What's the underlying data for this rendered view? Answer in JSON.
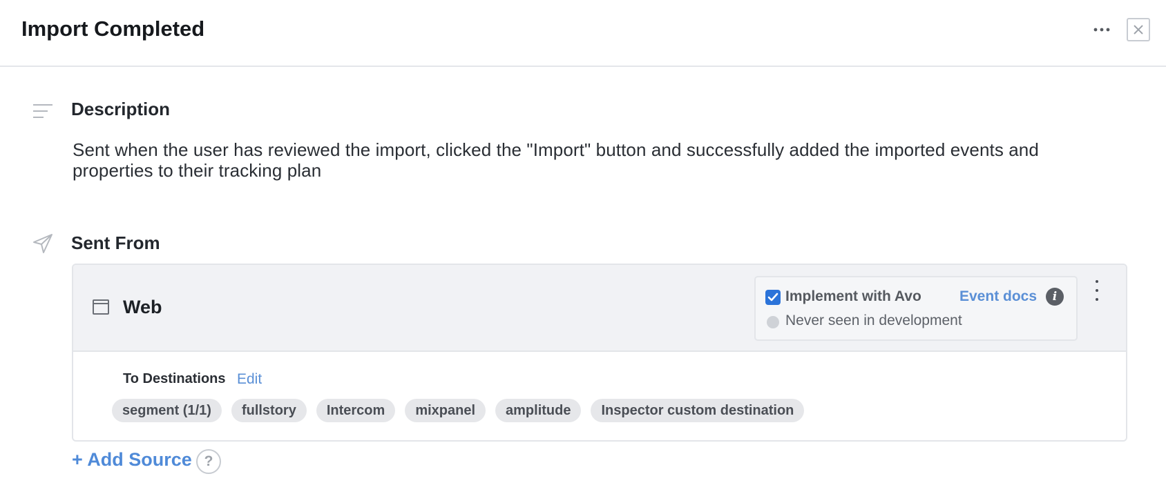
{
  "header": {
    "title": "Import Completed",
    "more_icon": "more-horizontal-icon",
    "close_icon": "close-icon"
  },
  "description": {
    "icon": "text-lines-icon",
    "heading": "Description",
    "text": "Sent when the user has reviewed the import, clicked the \"Import\" button and successfully added the imported events and properties to their tracking plan"
  },
  "sent_from": {
    "icon": "send-icon",
    "heading": "Sent From",
    "source": {
      "icon": "browser-window-icon",
      "name": "Web",
      "implement_label": "Implement with Avo",
      "implement_checked": true,
      "event_docs_label": "Event docs",
      "status_text": "Never seen in development",
      "destinations_label": "To Destinations",
      "edit_label": "Edit",
      "destinations": [
        "segment (1/1)",
        "fullstory",
        "Intercom",
        "mixpanel",
        "amplitude",
        "Inspector custom destination"
      ]
    },
    "add_source_label": "+ Add Source",
    "help_label": "?"
  },
  "colors": {
    "accent": "#5a8fd6",
    "checkbox": "#2b73d9",
    "pill_bg": "#e6e7ea",
    "card_header_bg": "#f1f2f5"
  }
}
